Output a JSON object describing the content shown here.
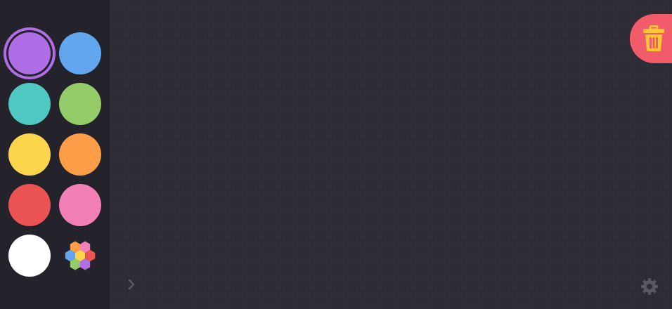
{
  "palette": {
    "swatches": [
      {
        "name": "purple",
        "color": "#b06ee6",
        "selected": true
      },
      {
        "name": "blue",
        "color": "#62a6ef"
      },
      {
        "name": "teal",
        "color": "#4fc8c2"
      },
      {
        "name": "green",
        "color": "#94cc69"
      },
      {
        "name": "yellow",
        "color": "#fcd54c"
      },
      {
        "name": "orange",
        "color": "#fd9d47"
      },
      {
        "name": "red",
        "color": "#eb5452"
      },
      {
        "name": "pink",
        "color": "#f37fb7"
      },
      {
        "name": "white",
        "color": "#ffffff"
      }
    ],
    "custom_picker_icon": "hexagon-color-wheel-icon",
    "custom_picker_colors": [
      "#fd9d47",
      "#f37fb7",
      "#62a6ef",
      "#fcd54c",
      "#eb5452",
      "#94cc69",
      "#b06ee6"
    ]
  },
  "toolbar": {
    "trash_icon": "trash-icon",
    "trash_bg": "#f25b6a",
    "trash_icon_color": "#fcc534",
    "expand_icon": "chevron-right-icon",
    "settings_icon": "gear-icon",
    "muted_icon_color": "#5a5963"
  },
  "theme": {
    "palette_bg": "#24232b",
    "canvas_bg": "#2e2d36"
  }
}
